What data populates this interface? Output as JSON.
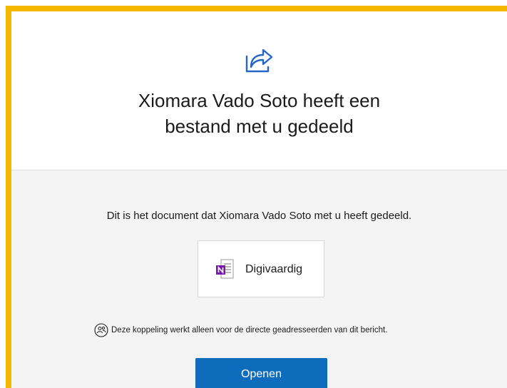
{
  "header": {
    "icon": "share-arrow-icon",
    "title_line1": "Xiomara Vado Soto heeft een",
    "title_line2": "bestand met u gedeeld"
  },
  "main": {
    "description": "Dit is het document dat Xiomara Vado Soto met u heeft gedeeld.",
    "file": {
      "icon": "onenote-icon",
      "name": "Digivaardig"
    },
    "notice": {
      "icon": "people-icon",
      "text": "Deze koppeling werkt alleen voor de directe geadresseerden van dit bericht."
    },
    "open_button_label": "Openen"
  },
  "colors": {
    "border_accent": "#f5b800",
    "button": "#0f6cbd",
    "icon_blue": "#2566c8",
    "onenote_purple": "#7719aa"
  }
}
